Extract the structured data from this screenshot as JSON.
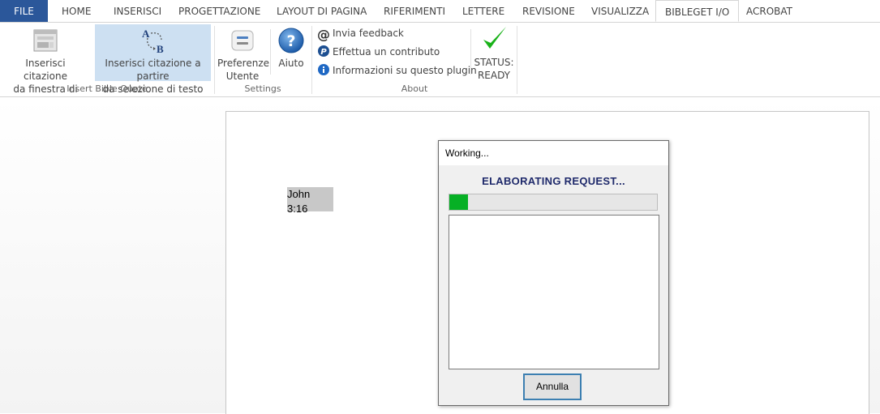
{
  "tabs": [
    {
      "label": "FILE"
    },
    {
      "label": "HOME"
    },
    {
      "label": "INSERISCI"
    },
    {
      "label": "PROGETTAZIONE"
    },
    {
      "label": "LAYOUT DI PAGINA"
    },
    {
      "label": "RIFERIMENTI"
    },
    {
      "label": "LETTERE"
    },
    {
      "label": "REVISIONE"
    },
    {
      "label": "VISUALIZZA"
    },
    {
      "label": "BIBLEGET I/O"
    },
    {
      "label": "ACROBAT"
    }
  ],
  "active_tab": "BIBLEGET I/O",
  "ribbon": {
    "insert_group": {
      "label": "Insert Bible Quote",
      "from_input_line1": "Inserisci citazione",
      "from_input_line2": "da finestra di input",
      "from_selection_line1": "Inserisci citazione a partire",
      "from_selection_line2": "da selezione di testo"
    },
    "settings_group": {
      "label": "Settings",
      "prefs_line1": "Preferenze",
      "prefs_line2": "Utente",
      "help": "Aiuto"
    },
    "about_group": {
      "label": "About",
      "feedback": "Invia feedback",
      "contribute": "Effettua un contributo",
      "info": "Informazioni su questo plugin"
    },
    "status": {
      "line1": "STATUS:",
      "line2": "READY",
      "color": "#19b219"
    }
  },
  "document": {
    "selected_text": "John 3:16"
  },
  "dialog": {
    "title": "Working...",
    "heading": "ELABORATING REQUEST...",
    "progress": 0.09,
    "cancel_label": "Annulla"
  },
  "colors": {
    "file_tab": "#2b579a",
    "selection": "#cde0f2",
    "progress": "#06b025"
  }
}
